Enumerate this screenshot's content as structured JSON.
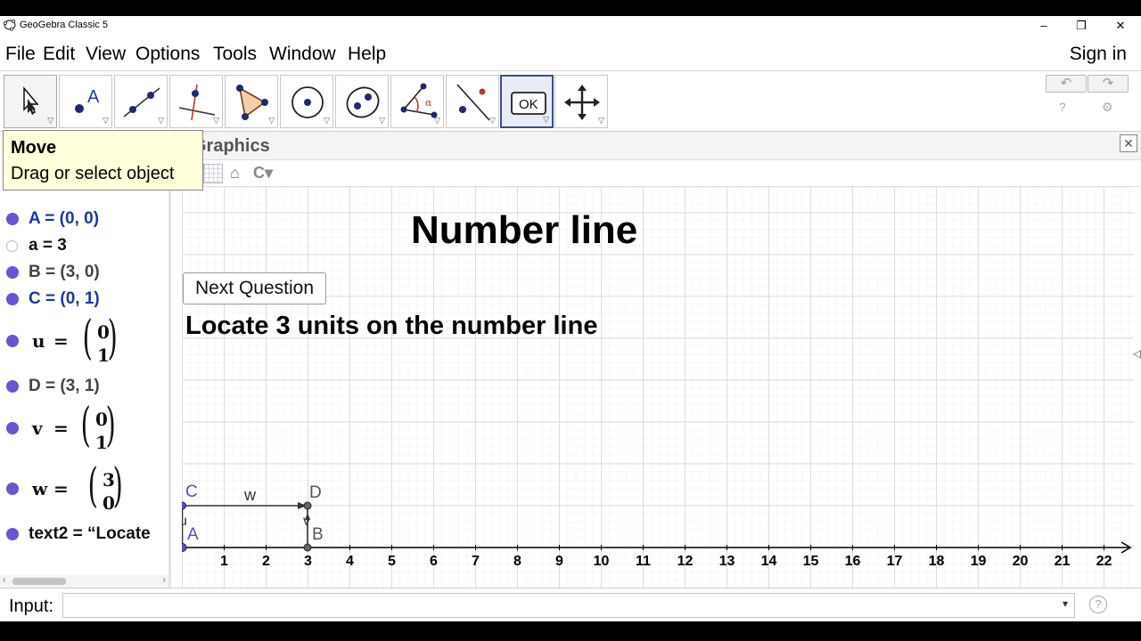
{
  "window": {
    "title": "GeoGebra Classic 5",
    "minimize": "–",
    "restore": "❐",
    "close": "✕"
  },
  "menu": {
    "items": [
      "File",
      "Edit",
      "View",
      "Options",
      "Tools",
      "Window",
      "Help"
    ],
    "sign_in": "Sign in"
  },
  "toolbar": {
    "tools": [
      {
        "icon": "move-tool-icon"
      },
      {
        "icon": "point-tool-icon",
        "label": "A"
      },
      {
        "icon": "line-tool-icon"
      },
      {
        "icon": "perpendicular-line-tool-icon"
      },
      {
        "icon": "polygon-tool-icon"
      },
      {
        "icon": "circle-tool-icon"
      },
      {
        "icon": "ellipse-tool-icon"
      },
      {
        "icon": "angle-tool-icon",
        "label": "α"
      },
      {
        "icon": "reflect-tool-icon"
      },
      {
        "icon": "button-tool-icon",
        "label": "OK"
      },
      {
        "icon": "move-graphics-view-tool-icon"
      }
    ],
    "undo": "↶",
    "redo": "↷",
    "help": "?",
    "settings": "⚙"
  },
  "tooltip": {
    "title": "Move",
    "description": "Drag or select object"
  },
  "algebra": {
    "A": "A = (0, 0)",
    "a": "a = 3",
    "B": "B = (3, 0)",
    "C": "C = (0, 1)",
    "u": {
      "name": "u",
      "eq": "=",
      "x": "0",
      "y": "1"
    },
    "D": "D = (3, 1)",
    "v": {
      "name": "v",
      "eq": "=",
      "x": "0",
      "y": "1"
    },
    "w": {
      "name": "w",
      "eq": "=",
      "x": "3",
      "y": "0"
    },
    "text2": "text2 = “Locate"
  },
  "graphics": {
    "title": "Graphics",
    "heading": "Number line",
    "next_button": "Next Question",
    "question": "Locate 3 units on the number line",
    "axis_labels": [
      "1",
      "2",
      "3",
      "4",
      "5",
      "6",
      "7",
      "8",
      "9",
      "10",
      "11",
      "12",
      "13",
      "14",
      "15",
      "16",
      "17",
      "18",
      "19",
      "20",
      "21",
      "22"
    ],
    "points": {
      "A": "A",
      "B": "B",
      "C": "C",
      "D": "D"
    },
    "vectors": {
      "u": "u",
      "v": "v",
      "w": "w"
    }
  },
  "colors": {
    "point_dot": "#6557d2",
    "blue_label": "#1a3a9c",
    "tooltip_bg": "#ffffdc",
    "grid_minor": "#ececec",
    "grid_major": "#d6d6d6"
  },
  "input": {
    "label": "Input:",
    "value": "",
    "dropdown": "▾",
    "help": "?"
  }
}
